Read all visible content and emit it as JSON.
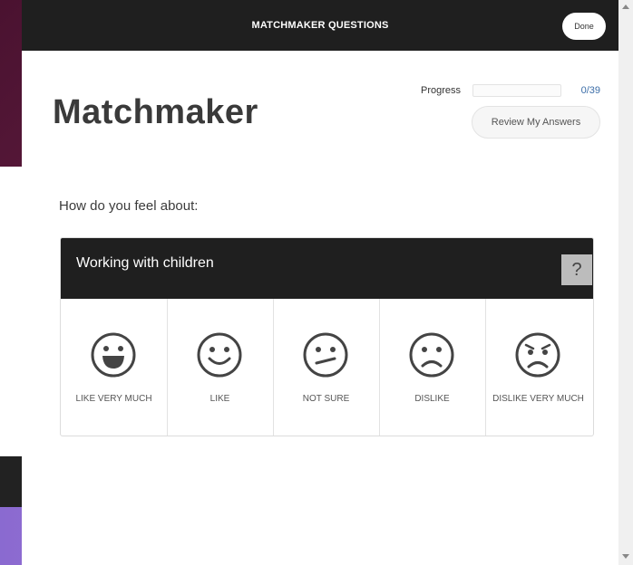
{
  "modal": {
    "title": "MATCHMAKER QUESTIONS",
    "done_label": "Done",
    "page_title": "Matchmaker",
    "progress": {
      "label": "Progress",
      "count": "0/39",
      "fraction": 0
    },
    "review_label": "Review My Answers",
    "prompt": "How do you feel about:",
    "question": {
      "text": "Working with children",
      "help_label": "?"
    },
    "options": [
      {
        "label": "LIKE VERY MUCH",
        "icon": "very-happy-face-icon"
      },
      {
        "label": "LIKE",
        "icon": "smile-face-icon"
      },
      {
        "label": "NOT SURE",
        "icon": "unsure-face-icon"
      },
      {
        "label": "DISLIKE",
        "icon": "frown-face-icon"
      },
      {
        "label": "DISLIKE VERY MUCH",
        "icon": "very-sad-face-icon"
      }
    ]
  },
  "background": {
    "nav_icons": [
      "search-icon",
      "heart-icon",
      "avatar"
    ]
  },
  "colors": {
    "header": "#1f1f1f",
    "maroon": "#5b1a3c",
    "purple": "#9a6fd4",
    "progress_text": "#3c6ea8"
  }
}
